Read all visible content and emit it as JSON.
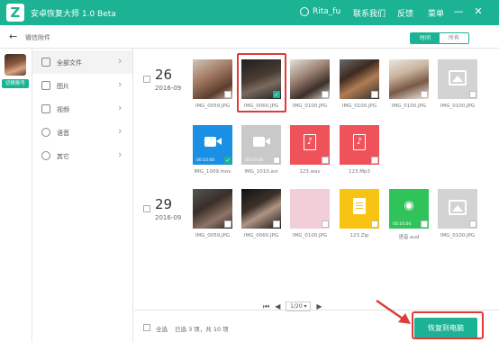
{
  "titlebar": {
    "app_title": "安卓恢复大师 1.0 Beta",
    "user": "Rita_fu",
    "contact": "联系我们",
    "feedback": "反馈",
    "menu": "菜单",
    "minimize": "—",
    "close": "✕"
  },
  "subbar": {
    "back": "←",
    "title": "微信附件",
    "view_time": "时间",
    "view_all": "所有"
  },
  "account": {
    "switch": "切换账号"
  },
  "sidebar": {
    "items": [
      {
        "label": "全部文件",
        "icon": "grid-icon"
      },
      {
        "label": "图片",
        "icon": "image-icon"
      },
      {
        "label": "视频",
        "icon": "video-icon"
      },
      {
        "label": "语音",
        "icon": "audio-icon"
      },
      {
        "label": "其它",
        "icon": "more-icon"
      }
    ]
  },
  "groups": [
    {
      "day": "26",
      "month": "2016-09",
      "files": [
        {
          "name": "IMG_0059.JPG",
          "kind": "photo",
          "checked": false
        },
        {
          "name": "IMG_0060.JPG",
          "kind": "photo",
          "checked": true
        },
        {
          "name": "IMG_0100.JPG",
          "kind": "photo",
          "checked": false
        },
        {
          "name": "IMG_0100.JPG",
          "kind": "photo",
          "checked": false
        },
        {
          "name": "IMG_0100.JPG",
          "kind": "photo",
          "checked": false
        },
        {
          "name": "IMG_0100.JPG",
          "kind": "placeholder",
          "checked": false
        },
        {
          "name": "IMG_1009.mov",
          "kind": "video",
          "time": "00:10:00",
          "checked": true
        },
        {
          "name": "IMG_1010.avi",
          "kind": "video-gray",
          "time": "00:10:00",
          "checked": false
        },
        {
          "name": "123.wav",
          "kind": "audio",
          "checked": false
        },
        {
          "name": "123.Mp3",
          "kind": "audio",
          "checked": false
        }
      ]
    },
    {
      "day": "29",
      "month": "2016-09",
      "files": [
        {
          "name": "IMG_0059.JPG",
          "kind": "photo",
          "checked": false
        },
        {
          "name": "IMG_0060.JPG",
          "kind": "photo",
          "checked": false
        },
        {
          "name": "IMG_0100.JPG",
          "kind": "photo",
          "checked": false
        },
        {
          "name": "123.Zip",
          "kind": "zip",
          "checked": false
        },
        {
          "name": "语音.aud",
          "kind": "voice",
          "time": "00:10:00",
          "checked": false
        },
        {
          "name": "IMG_0100.JPG",
          "kind": "placeholder",
          "checked": false
        }
      ]
    }
  ],
  "pager": {
    "first": "⏮",
    "prev": "◀",
    "page": "1/20 ▾",
    "next": "▶"
  },
  "footer": {
    "select_all": "全选",
    "selection_info": "已选 3 项，共 10 项",
    "recover": "恢复到电脑"
  },
  "colors": {
    "accent": "#1bb394",
    "highlight": "#e03a3a"
  }
}
